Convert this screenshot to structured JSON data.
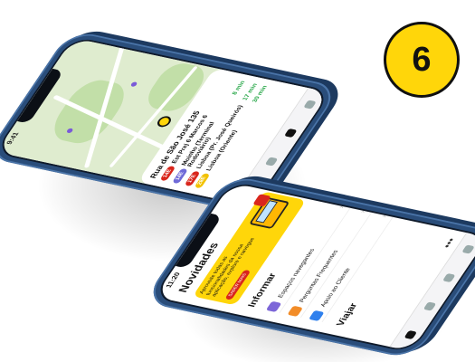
{
  "badge": {
    "number": "6"
  },
  "phone1": {
    "status_time": "9:41",
    "address": "Rua de São José 135",
    "address_sub": "",
    "routes": [
      {
        "tag": "14E",
        "tag_color": "#d9261c",
        "name": "Est Prej 6 Marcos 6",
        "eta": ""
      },
      {
        "tag": "14E",
        "tag_color": "#6f6ad8",
        "name": "Moinho (Terminal Rodoviário)",
        "eta": "8 min"
      },
      {
        "tag": "17E",
        "tag_color": "#d9261c",
        "name": "Lisboa (Pr. José Queirós)",
        "eta": "17 min"
      },
      {
        "tag": "28E",
        "tag_color": "#f2c200",
        "name": "Lisboa (Oriente)",
        "eta": "30 min"
      }
    ]
  },
  "phone2": {
    "status_time": "11:20",
    "title": "Novidades",
    "banner": {
      "text": "Aproveite todas as funcionalidades da nossa aplicação, explore e navegue",
      "button": "SABER MAIS"
    },
    "section_informar": "Informar",
    "items": [
      {
        "label": "Espaços navegantes",
        "icon": "navigation-icon",
        "color": "#7c66d8"
      },
      {
        "label": "Perguntas Frequentes",
        "icon": "question-icon",
        "color": "#f28c28"
      },
      {
        "label": "Apoio ao Cliente",
        "icon": "chat-icon",
        "color": "#2f80ed"
      }
    ],
    "section_viajar": "Viajar",
    "more": "•••"
  },
  "colors": {
    "accent": "#ffd60a",
    "phone_body": "#2a4d7a"
  }
}
